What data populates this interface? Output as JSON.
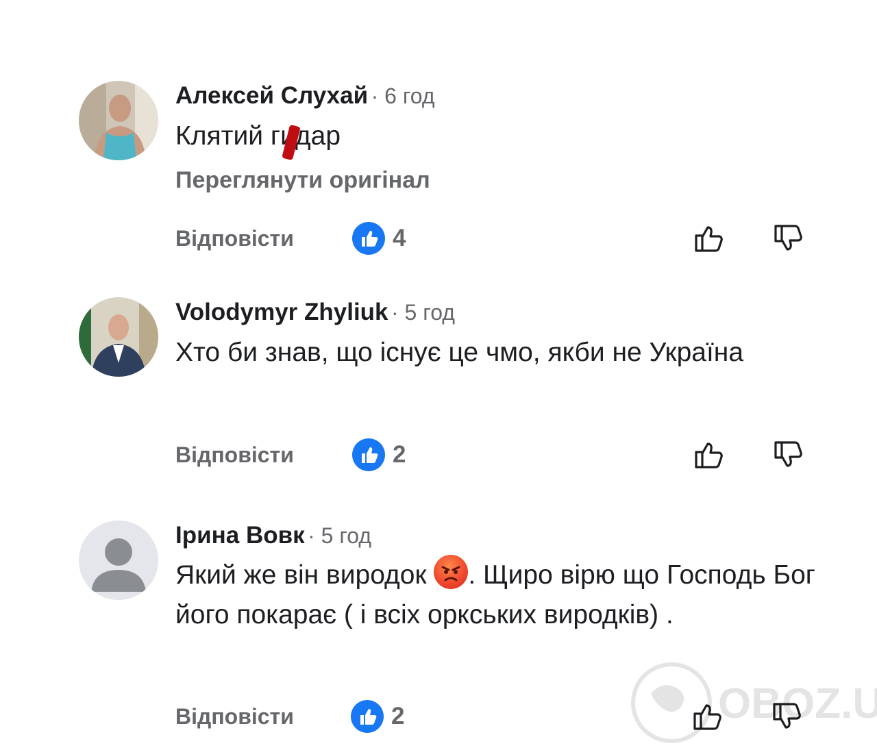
{
  "comments": [
    {
      "author": "Алексей Слухай",
      "time": "· 6 год",
      "text": "Клятий гидар",
      "text_before": "Клятий г",
      "text_mid": "и",
      "text_after": "дар",
      "see_original": "Переглянути оригінал",
      "reply": "Відповісти",
      "likes": "4"
    },
    {
      "author": "Volodymyr Zhyliuk",
      "time": "· 5 год",
      "text": "Хто би знав, що існує це чмо, якби не Україна",
      "reply": "Відповісти",
      "likes": "2"
    },
    {
      "author": "Ірина Вовк",
      "time": "· 5 год",
      "text_before": "Який же він виродок ",
      "emoji": "angry-face-emoji",
      "text_after": ". Щиро вірю що Господь Бог його покарає ( і всіх оркських виродків) .",
      "reply": "Відповісти",
      "likes": "2"
    }
  ],
  "watermark": "OBOZ.UA",
  "colors": {
    "like_blue": "#1877f2",
    "secondary_text": "#65676b",
    "primary_text": "#1c1e21",
    "censor_red": "#c00d12"
  }
}
